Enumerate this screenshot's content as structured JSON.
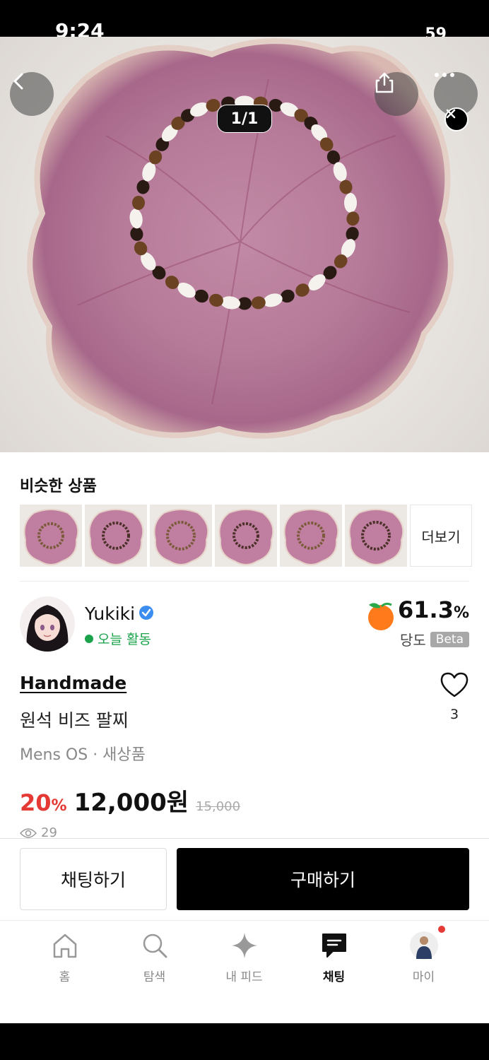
{
  "status_bar": {
    "time": "9:24",
    "battery": "59"
  },
  "gallery": {
    "counter": "1/1",
    "dots": [
      true,
      false,
      false
    ]
  },
  "similar": {
    "title": "비슷한 상품",
    "more_label": "더보기",
    "thumb_count": 6
  },
  "seller": {
    "name": "Yukiki",
    "activity": "오늘 활동",
    "sweetness_value": "61.3",
    "sweetness_unit": "%",
    "sweetness_label": "당도",
    "beta": "Beta"
  },
  "product": {
    "brand": "Handmade",
    "name": "원석 비즈 팔찌",
    "meta": "Mens OS · 새상품",
    "discount": "20",
    "discount_unit": "%",
    "price": "12,000원",
    "original_price": "15,000",
    "views": "29",
    "likes": "3"
  },
  "actions": {
    "chat_label": "채팅하기",
    "buy_label": "구매하기"
  },
  "tabs": [
    {
      "label": "홈",
      "icon": "home-icon"
    },
    {
      "label": "탐색",
      "icon": "search-icon"
    },
    {
      "label": "내 피드",
      "icon": "sparkle-icon"
    },
    {
      "label": "채팅",
      "icon": "chat-icon"
    },
    {
      "label": "마이",
      "icon": "profile-avatar-icon"
    }
  ],
  "colors": {
    "accent_red": "#e53935",
    "activity_green": "#1aa34a",
    "verified_blue": "#3b8df0",
    "peach_orange": "#ff7a1a"
  }
}
